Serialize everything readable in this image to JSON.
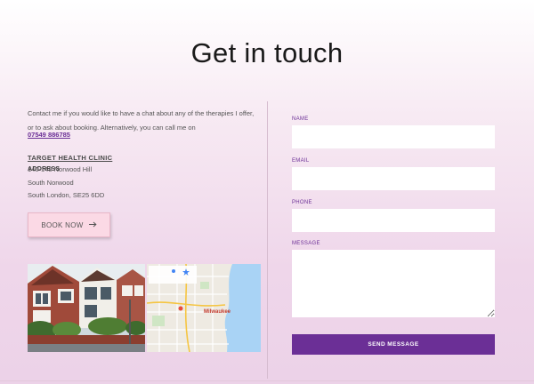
{
  "header": {
    "title": "Get in touch"
  },
  "contact": {
    "intro": "Contact me if you would like to have a chat about any of the therapies I offer, or to ask about booking. Alternatively, you can call me on",
    "phone": "07549 886785",
    "clinic_name": "TARGET HEALTH CLINIC",
    "address_label": "ADDRESS",
    "address_lines": [
      "140-148 Norwood Hill",
      "South Norwood",
      "South London, SE25 6DD"
    ],
    "book_label": "BOOK NOW"
  },
  "map": {
    "city_label": "Milwaukee"
  },
  "form": {
    "name_label": "NAME",
    "email_label": "EMAIL",
    "phone_label": "PHONE",
    "message_label": "MESSAGE",
    "send_label": "SEND MESSAGE"
  },
  "colors": {
    "accent": "#6b2f96",
    "book_button": "#fbd9e5",
    "background_bottom": "#ecd2e8"
  }
}
